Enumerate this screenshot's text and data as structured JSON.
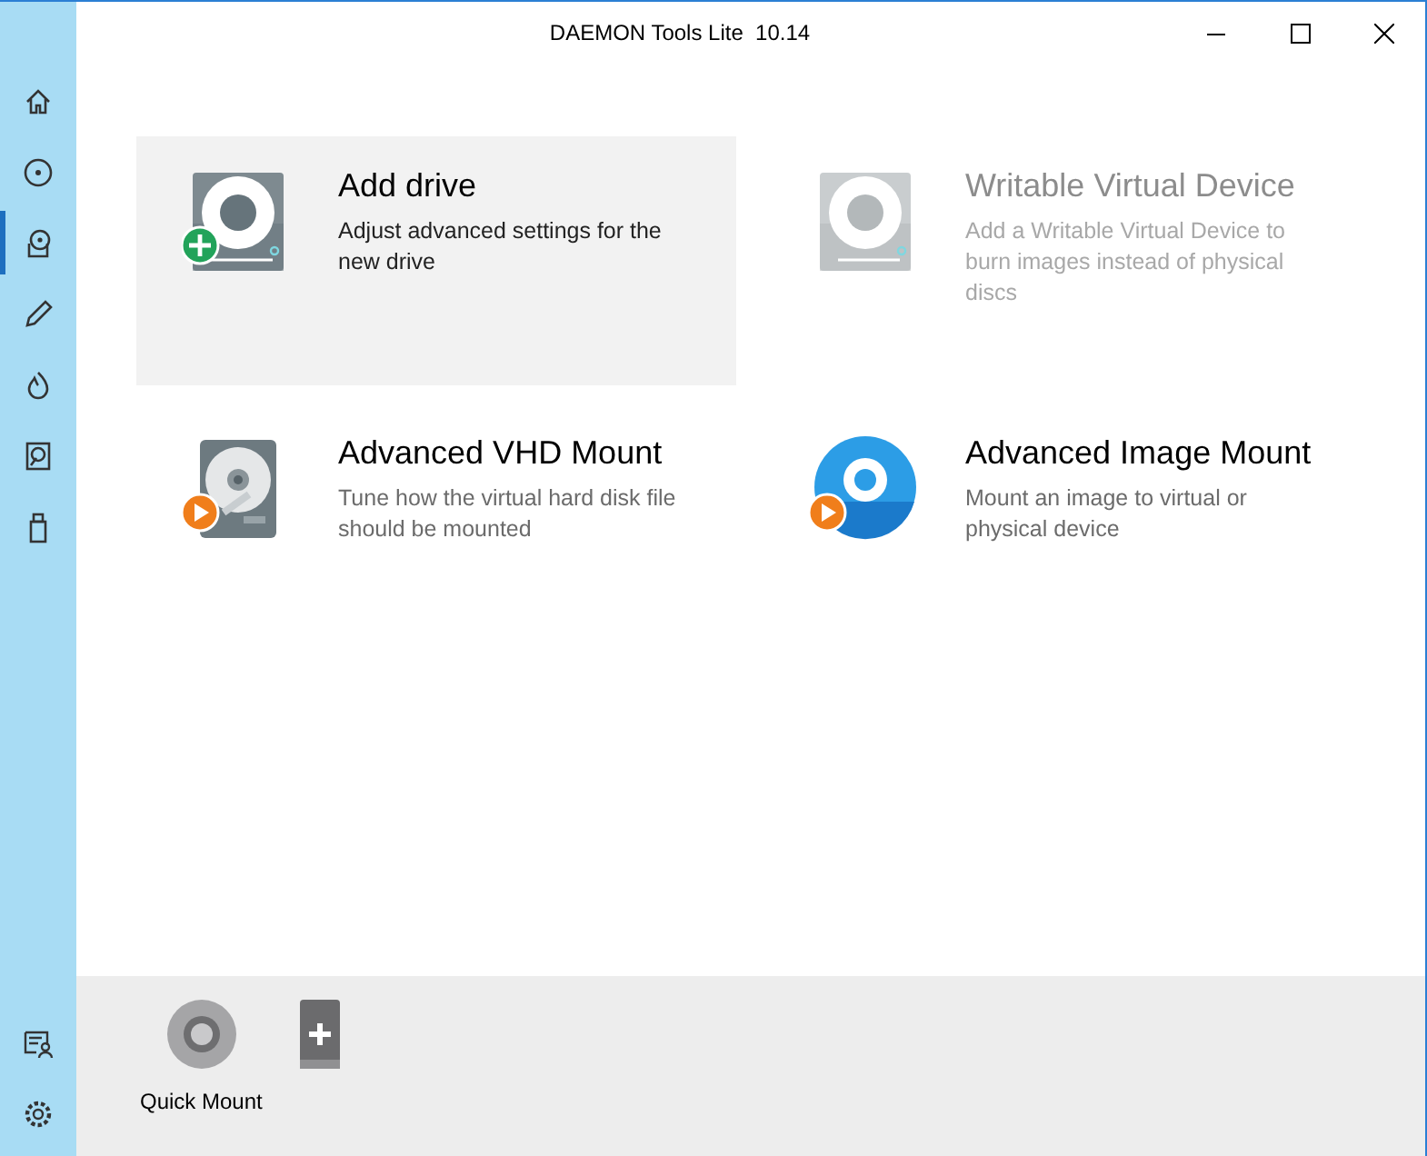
{
  "window": {
    "title": "DAEMON Tools Lite  10.14"
  },
  "sidebar": {
    "items": [
      {
        "kind": "home",
        "selected": false
      },
      {
        "kind": "disc",
        "selected": false
      },
      {
        "kind": "drive",
        "selected": true
      },
      {
        "kind": "pencil",
        "selected": false
      },
      {
        "kind": "flame",
        "selected": false
      },
      {
        "kind": "vhd",
        "selected": false
      },
      {
        "kind": "usb",
        "selected": false
      }
    ],
    "bottom_items": [
      {
        "kind": "license"
      },
      {
        "kind": "settings"
      }
    ]
  },
  "cards": [
    {
      "kind": "add-drive",
      "title": "Add drive",
      "description": "Adjust advanced settings for the new drive",
      "hovered": true,
      "disabled": false
    },
    {
      "kind": "writable",
      "title": "Writable Virtual Device",
      "description": "Add a Writable Virtual Device to burn images instead of physical discs",
      "hovered": false,
      "disabled": true
    },
    {
      "kind": "vhd",
      "title": "Advanced VHD Mount",
      "description": "Tune how the virtual hard disk file should be mounted",
      "hovered": false,
      "disabled": false
    },
    {
      "kind": "image",
      "title": "Advanced Image Mount",
      "description": "Mount an image to virtual or physical device",
      "hovered": false,
      "disabled": false
    }
  ],
  "quick_bar": [
    {
      "kind": "quick-mount",
      "label": "Quick Mount"
    },
    {
      "kind": "add-device"
    }
  ]
}
